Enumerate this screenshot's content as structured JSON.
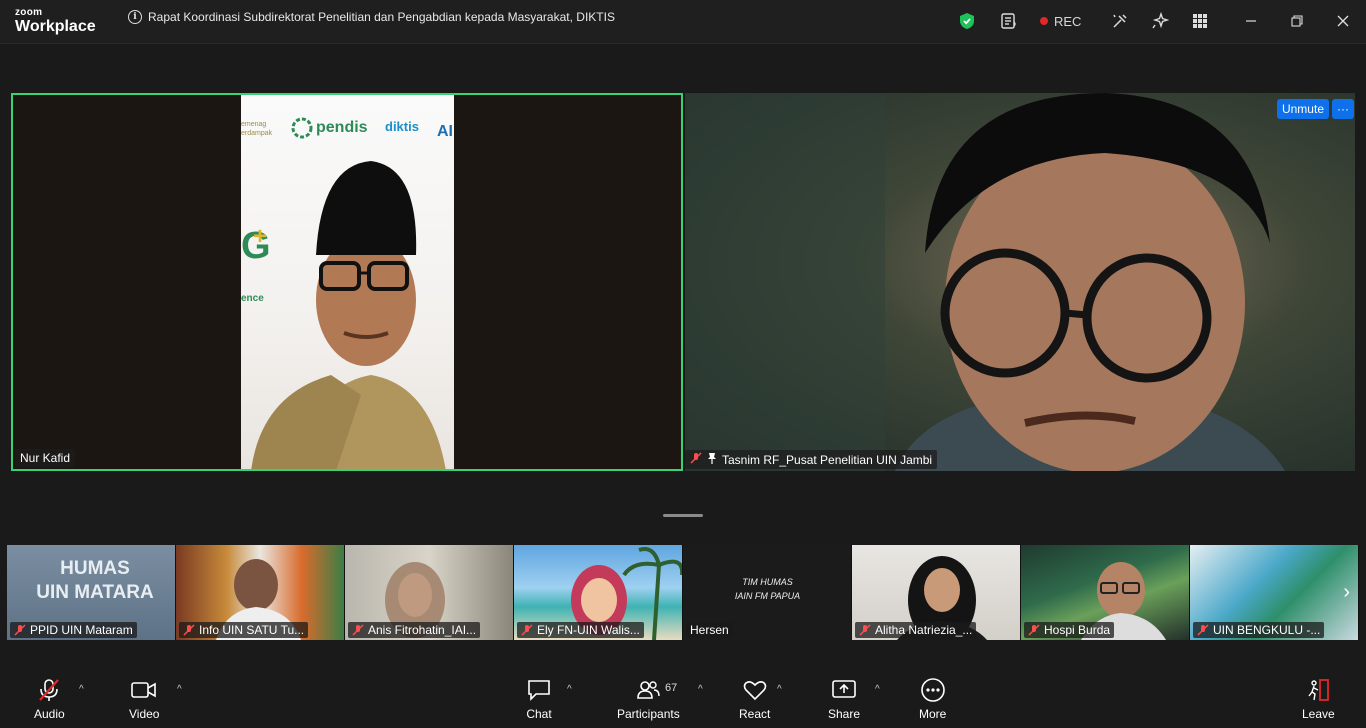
{
  "app": {
    "brand_small": "zoom",
    "brand_large": "Workplace"
  },
  "meeting": {
    "title": "Rapat Koordinasi Subdirektorat Penelitian dan Pengabdian kepada Masyarakat, DIKTIS"
  },
  "titlebar": {
    "rec_label": "REC"
  },
  "main_videos": [
    {
      "name": "Nur Kafid",
      "muted": false,
      "active_speaker": true,
      "banner_logos": [
        "pendis",
        "diktis"
      ],
      "banner_text_1": "emenag",
      "banner_text_2": "erdampak",
      "banner_text_3": "ence"
    },
    {
      "name": "Tasnim RF_Pusat Penelitian UIN Jambi",
      "muted": true,
      "pinned": true,
      "unmute_label": "Unmute",
      "more_label": "···"
    }
  ],
  "gallery": [
    {
      "name": "PPID UIN Mataram",
      "overlay_line1": "HUMAS",
      "overlay_line2": "UIN MATARA"
    },
    {
      "name": "Info UIN SATU Tu..."
    },
    {
      "name": "Anis Fitrohatin_IAI..."
    },
    {
      "name": "Ely FN-UIN Walis..."
    },
    {
      "name": "Hersen",
      "overlay_line1": "TIM HUMAS",
      "overlay_line2": "IAIN FM PAPUA"
    },
    {
      "name": "Alitha Natriezia_..."
    },
    {
      "name": "Hospi Burda"
    },
    {
      "name": "UIN BENGKULU -..."
    }
  ],
  "toolbar": {
    "audio": "Audio",
    "video": "Video",
    "chat": "Chat",
    "participants": "Participants",
    "participants_count": "67",
    "react": "React",
    "share": "Share",
    "more": "More",
    "leave": "Leave"
  },
  "colors": {
    "accent": "#0e71eb",
    "active_speaker": "#37d17a",
    "recording": "#e02828",
    "muted": "#ff4d4d",
    "leave": "#e02828"
  }
}
